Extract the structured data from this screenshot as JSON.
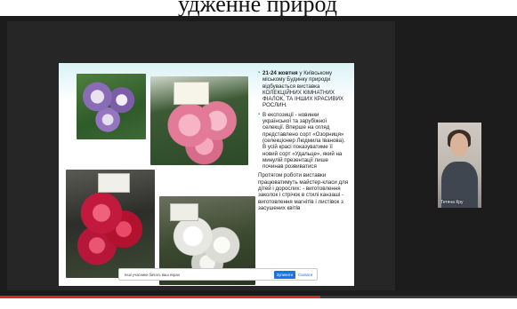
{
  "top_caption": "удженне природ",
  "slide": {
    "paragraphs": [
      {
        "bold": "21-24 жовтня",
        "text": " у Київському міському Будинку природи відбувається виставка КОЛЕКЦІЙНИХ КІМНАТНИХ ФІАЛОК, ТА ІНШИХ КРАСИВИХ РОСЛИН."
      },
      {
        "bold": "",
        "text": "В експозиції - новинки української та зарубіжної селекції. Вперше на огляд представлено сорт «Озорниця» (селекціонер Людмила Іванова). В усій красі показуватиме її новий сорт «Удальце», який на минулій презентації лише починав розвиватися"
      }
    ],
    "tail": "Протягом роботи виставки працюватимуть майстер-класи для дітей і дорослих: - виготовлення заколок і стрічок в стилі канзаші - виготовлення магнітів і листівок з засушених квітів"
  },
  "share_bar": {
    "message": "Інші учасники бачать ваш екран",
    "stop_label": "Зупинити",
    "hide_label": "Сховати"
  },
  "participant": {
    "name": "Тетяна Кру"
  },
  "progress": {
    "played_fraction": 0.62
  },
  "colors": {
    "accent_red": "#e0242c",
    "share_blue": "#1a73e8"
  }
}
